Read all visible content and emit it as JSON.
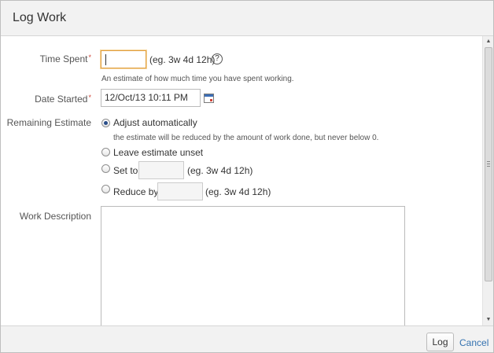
{
  "dialog": {
    "title": "Log Work"
  },
  "time_spent": {
    "label": "Time Spent",
    "required_mark": "*",
    "value": "",
    "hint": "(eg. 3w 4d 12h)",
    "help_symbol": "?",
    "description": "An estimate of how much time you have spent working."
  },
  "date_started": {
    "label": "Date Started",
    "required_mark": "*",
    "value": "12/Oct/13 10:11 PM"
  },
  "remaining_estimate": {
    "label": "Remaining Estimate",
    "options": [
      {
        "label": "Adjust automatically",
        "checked": true,
        "description": "the estimate will be reduced by the amount of work done, but never below 0."
      },
      {
        "label": "Leave estimate unset",
        "checked": false
      },
      {
        "label": "Set to",
        "checked": false,
        "value": "",
        "hint": "(eg. 3w 4d 12h)"
      },
      {
        "label": "Reduce by",
        "checked": false,
        "value": "",
        "hint": "(eg. 3w 4d 12h)"
      }
    ]
  },
  "work_description": {
    "label": "Work Description",
    "value": ""
  },
  "footer": {
    "log_label": "Log",
    "cancel_label": "Cancel"
  },
  "colors": {
    "accent": "#3572b0",
    "required": "#d04437",
    "focus": "#e0a042"
  }
}
